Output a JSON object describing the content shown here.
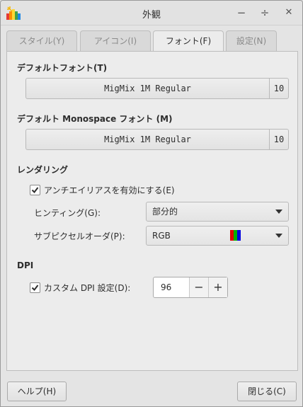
{
  "window": {
    "title": "外観",
    "controls": {
      "minimize": "−",
      "maximize": "÷",
      "close": "✕"
    }
  },
  "tabs": [
    {
      "label": "スタイル(Y)",
      "active": false
    },
    {
      "label": "アイコン(I)",
      "active": false
    },
    {
      "label": "フォント(F)",
      "active": true
    },
    {
      "label": "設定(N)",
      "active": false
    }
  ],
  "default_font": {
    "heading": "デフォルトフォント(T)",
    "name": "MigMix 1M Regular",
    "size": "10"
  },
  "mono_font": {
    "heading": "デフォルト Monospace フォント (M)",
    "name": "MigMix 1M Regular",
    "size": "10"
  },
  "rendering": {
    "heading": "レンダリング",
    "antialias_label": "アンチエイリアスを有効にする(E)",
    "antialias_checked": true,
    "hinting_label": "ヒンティング(G):",
    "hinting_value": "部分的",
    "subpixel_label": "サブピクセルオーダ(P):",
    "subpixel_value": "RGB",
    "subpixel_icon": "rgb-stripes-icon"
  },
  "dpi": {
    "heading": "DPI",
    "custom_label": "カスタム DPI 設定(D):",
    "custom_checked": true,
    "value": "96",
    "decrement": "−",
    "increment": "+"
  },
  "footer": {
    "help_label": "ヘルプ(H)",
    "close_label": "閉じる(C)"
  },
  "colors": {
    "window_bg": "#e4e4e4",
    "panel_bg": "#ececec",
    "text": "#2d2d2d",
    "disabled_text": "#8a8a8a"
  }
}
